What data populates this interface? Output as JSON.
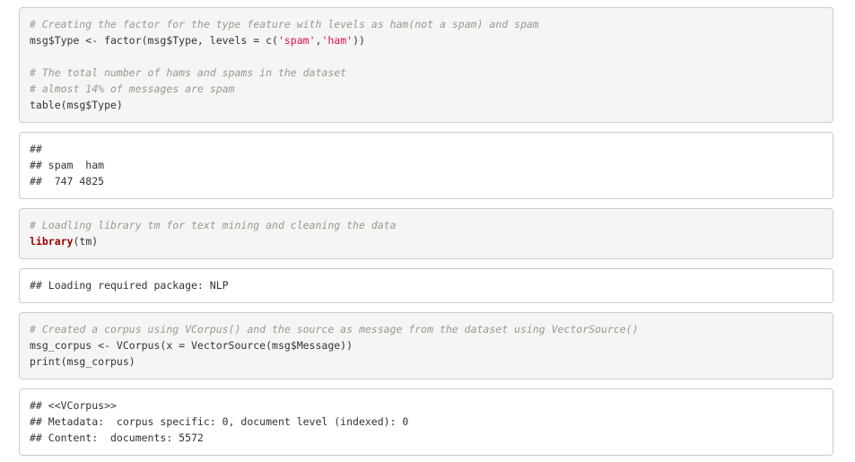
{
  "chunks": [
    {
      "type": "code",
      "lines": [
        [
          {
            "t": "cmt",
            "v": "# Creating the factor for the type feature with levels as ham(not a spam) and spam"
          }
        ],
        [
          {
            "t": "txt",
            "v": "msg$Type <- factor(msg$Type, levels = c("
          },
          {
            "t": "str",
            "v": "'spam'"
          },
          {
            "t": "txt",
            "v": ","
          },
          {
            "t": "str",
            "v": "'ham'"
          },
          {
            "t": "txt",
            "v": "))"
          }
        ],
        [],
        [
          {
            "t": "cmt",
            "v": "# The total number of hams and spams in the dataset"
          }
        ],
        [
          {
            "t": "cmt",
            "v": "# almost 14% of messages are spam"
          }
        ],
        [
          {
            "t": "txt",
            "v": "table(msg$Type)"
          }
        ]
      ]
    },
    {
      "type": "output",
      "lines": [
        [
          {
            "t": "txt",
            "v": "##"
          }
        ],
        [
          {
            "t": "txt",
            "v": "## spam  ham"
          }
        ],
        [
          {
            "t": "txt",
            "v": "##  747 4825"
          }
        ]
      ]
    },
    {
      "type": "code",
      "lines": [
        [
          {
            "t": "cmt",
            "v": "# Loadling library tm for text mining and cleaning the data"
          }
        ],
        [
          {
            "t": "kw",
            "v": "library"
          },
          {
            "t": "txt",
            "v": "(tm)"
          }
        ]
      ]
    },
    {
      "type": "output",
      "lines": [
        [
          {
            "t": "txt",
            "v": "## Loading required package: NLP"
          }
        ]
      ]
    },
    {
      "type": "code",
      "lines": [
        [
          {
            "t": "cmt",
            "v": "# Created a corpus using VCorpus() and the source as message from the dataset using VectorSource()"
          }
        ],
        [
          {
            "t": "txt",
            "v": "msg_corpus <- VCorpus(x = VectorSource(msg$Message))"
          }
        ],
        [
          {
            "t": "txt",
            "v": "print(msg_corpus)"
          }
        ]
      ]
    },
    {
      "type": "output",
      "lines": [
        [
          {
            "t": "txt",
            "v": "## <<VCorpus>>"
          }
        ],
        [
          {
            "t": "txt",
            "v": "## Metadata:  corpus specific: 0, document level (indexed): 0"
          }
        ],
        [
          {
            "t": "txt",
            "v": "## Content:  documents: 5572"
          }
        ]
      ]
    }
  ]
}
